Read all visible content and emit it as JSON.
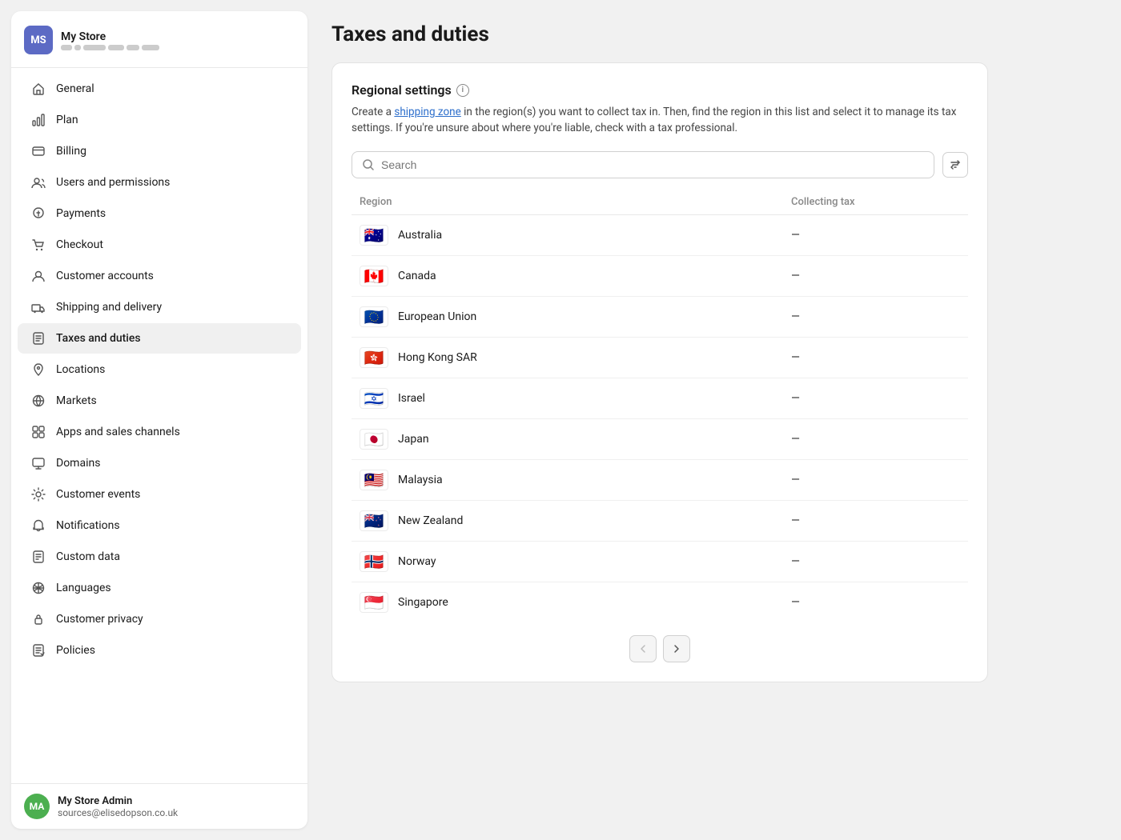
{
  "store": {
    "initials": "MS",
    "name": "My Store",
    "avatar_color": "#5c6ac4"
  },
  "admin": {
    "initials": "MA",
    "name": "My Store Admin",
    "email": "sources@elisedopson.co.uk",
    "avatar_color": "#4caf50"
  },
  "sidebar": {
    "items": [
      {
        "id": "general",
        "label": "General",
        "icon": "house"
      },
      {
        "id": "plan",
        "label": "Plan",
        "icon": "chart"
      },
      {
        "id": "billing",
        "label": "Billing",
        "icon": "billing"
      },
      {
        "id": "users",
        "label": "Users and permissions",
        "icon": "users"
      },
      {
        "id": "payments",
        "label": "Payments",
        "icon": "payments"
      },
      {
        "id": "checkout",
        "label": "Checkout",
        "icon": "checkout"
      },
      {
        "id": "customer-accounts",
        "label": "Customer accounts",
        "icon": "customer"
      },
      {
        "id": "shipping",
        "label": "Shipping and delivery",
        "icon": "shipping"
      },
      {
        "id": "taxes",
        "label": "Taxes and duties",
        "icon": "taxes",
        "active": true
      },
      {
        "id": "locations",
        "label": "Locations",
        "icon": "location"
      },
      {
        "id": "markets",
        "label": "Markets",
        "icon": "markets"
      },
      {
        "id": "apps",
        "label": "Apps and sales channels",
        "icon": "apps"
      },
      {
        "id": "domains",
        "label": "Domains",
        "icon": "domains"
      },
      {
        "id": "customer-events",
        "label": "Customer events",
        "icon": "events"
      },
      {
        "id": "notifications",
        "label": "Notifications",
        "icon": "notifications"
      },
      {
        "id": "custom-data",
        "label": "Custom data",
        "icon": "custom"
      },
      {
        "id": "languages",
        "label": "Languages",
        "icon": "languages"
      },
      {
        "id": "privacy",
        "label": "Customer privacy",
        "icon": "privacy"
      },
      {
        "id": "policies",
        "label": "Policies",
        "icon": "policies"
      }
    ]
  },
  "page": {
    "title": "Taxes and duties"
  },
  "regional_settings": {
    "section_title": "Regional settings",
    "description_prefix": "Create a ",
    "description_link": "shipping zone",
    "description_suffix": " in the region(s) you want to collect tax in. Then, find the region in this list and select it to manage its tax settings. If you're unsure about where you're liable, check with a tax professional.",
    "search_placeholder": "Search",
    "col_region": "Region",
    "col_tax": "Collecting tax",
    "regions": [
      {
        "name": "Australia",
        "flag": "🇦🇺",
        "tax": "—"
      },
      {
        "name": "Canada",
        "flag": "🇨🇦",
        "tax": "—"
      },
      {
        "name": "European Union",
        "flag": "🇪🇺",
        "tax": "—"
      },
      {
        "name": "Hong Kong SAR",
        "flag": "🇭🇰",
        "tax": "—"
      },
      {
        "name": "Israel",
        "flag": "🇮🇱",
        "tax": "—"
      },
      {
        "name": "Japan",
        "flag": "🇯🇵",
        "tax": "—"
      },
      {
        "name": "Malaysia",
        "flag": "🇲🇾",
        "tax": "—"
      },
      {
        "name": "New Zealand",
        "flag": "🇳🇿",
        "tax": "—"
      },
      {
        "name": "Norway",
        "flag": "🇳🇴",
        "tax": "—"
      },
      {
        "name": "Singapore",
        "flag": "🇸🇬",
        "tax": "—"
      }
    ],
    "pagination_prev": "‹",
    "pagination_next": "›"
  }
}
